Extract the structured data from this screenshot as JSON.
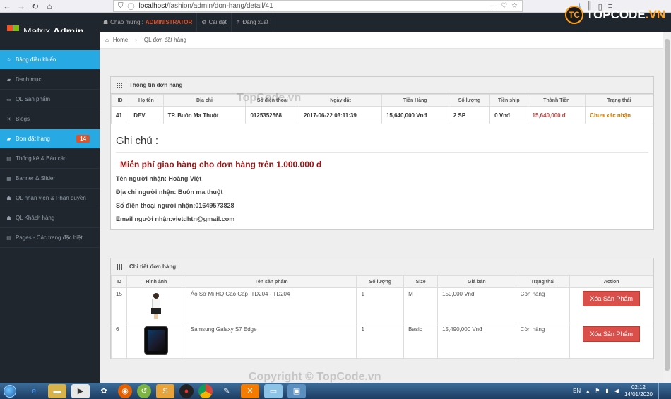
{
  "browser": {
    "url_prefix": "localhost",
    "url_path": "/fashion/admin/don-hang/detail/41"
  },
  "brand": {
    "name_light": "Matrix ",
    "name_bold": "Admin"
  },
  "watermark_logo": {
    "mark": "TC",
    "text": "TOPCODE",
    "ext": ".VN"
  },
  "top_nav": {
    "welcome": "Chào mừng : ",
    "admin": "ADMINISTRATOR",
    "settings": "Cài đặt",
    "logout": "Đăng xuất"
  },
  "sidebar": {
    "items": [
      {
        "label": "Bảng điều khiển",
        "icon": "home-icon",
        "glyph": "⌂",
        "active": true
      },
      {
        "label": "Danh mục",
        "icon": "folder-icon",
        "glyph": "▰",
        "active": false
      },
      {
        "label": "QL Sản phẩm",
        "icon": "tag-icon",
        "glyph": "▭",
        "active": false
      },
      {
        "label": "Blogs",
        "icon": "tools-icon",
        "glyph": "✕",
        "active": false
      },
      {
        "label": "Đơn đặt hàng",
        "icon": "cart-icon",
        "glyph": "▰",
        "active": true,
        "badge": "14"
      },
      {
        "label": "Thống kê & Báo cáo",
        "icon": "chart-icon",
        "glyph": "▤",
        "active": false
      },
      {
        "label": "Banner & Slider",
        "icon": "picture-icon",
        "glyph": "▦",
        "active": false
      },
      {
        "label": "QL nhân viên & Phân quyền",
        "icon": "user-icon",
        "glyph": "☗",
        "active": false
      },
      {
        "label": "QL Khách hàng",
        "icon": "user-icon",
        "glyph": "☗",
        "active": false
      },
      {
        "label": "Pages - Các trang đặc biệt",
        "icon": "file-icon",
        "glyph": "▤",
        "active": false
      }
    ]
  },
  "breadcrumb": {
    "home": "Home",
    "current": "QL đơn đặt hàng"
  },
  "order_info": {
    "title": "Thông tin đơn hàng",
    "headers": [
      "ID",
      "Họ tên",
      "Địa chỉ",
      "Số điện thoại",
      "Ngày đặt",
      "Tiền Hàng",
      "Số lượng",
      "Tiền ship",
      "Thành Tiền",
      "Trạng thái"
    ],
    "row": {
      "id": "41",
      "name": "DEV",
      "address": "TP. Buôn Ma Thuột",
      "phone": "0125352568",
      "date": "2017-06-22 03:11:39",
      "goods_total": "15,640,000 Vnđ",
      "quantity": "2 SP",
      "shipping": "0 Vnđ",
      "total": "15,640,000 đ",
      "status": "Chưa xác nhận"
    }
  },
  "notes": {
    "title": "Ghi chú :",
    "promo": "Miễn phí giao hàng cho đơn hàng trên 1.000.000 đ",
    "recipient": "Tên người nhận: Hoàng Việt",
    "address": "Địa chỉ người nhận: Buôn ma thuột",
    "phone": "Số điện thoại người nhận:01649573828",
    "email": "Email người nhận:vietdhtn@gmail.com"
  },
  "order_details": {
    "title": "Chi tiết đơn hàng",
    "headers": [
      "ID",
      "Hình ảnh",
      "Tên sản phẩm",
      "Số lượng",
      "Size",
      "Giá bán",
      "Trạng thái",
      "Action"
    ],
    "rows": [
      {
        "id": "15",
        "product": "Áo Sơ Mi HQ Cao Cấp_TD204 - TD204",
        "quantity": "1",
        "size": "M",
        "price": "150,000 Vnđ",
        "status": "Còn hàng",
        "action": "Xóa Sản Phẩm",
        "image": "shirt-model"
      },
      {
        "id": "6",
        "product": "Samsung Galaxy S7 Edge",
        "quantity": "1",
        "size": "Basic",
        "price": "15,490,000 Vnđ",
        "status": "Còn hàng",
        "action": "Xóa Sản Phẩm",
        "image": "phone"
      }
    ]
  },
  "watermarks": {
    "center": "TopCode.vn",
    "bottom": "Copyright © TopCode.vn"
  },
  "taskbar": {
    "lang": "EN",
    "time": "02:12",
    "date": "14/01/2020"
  }
}
